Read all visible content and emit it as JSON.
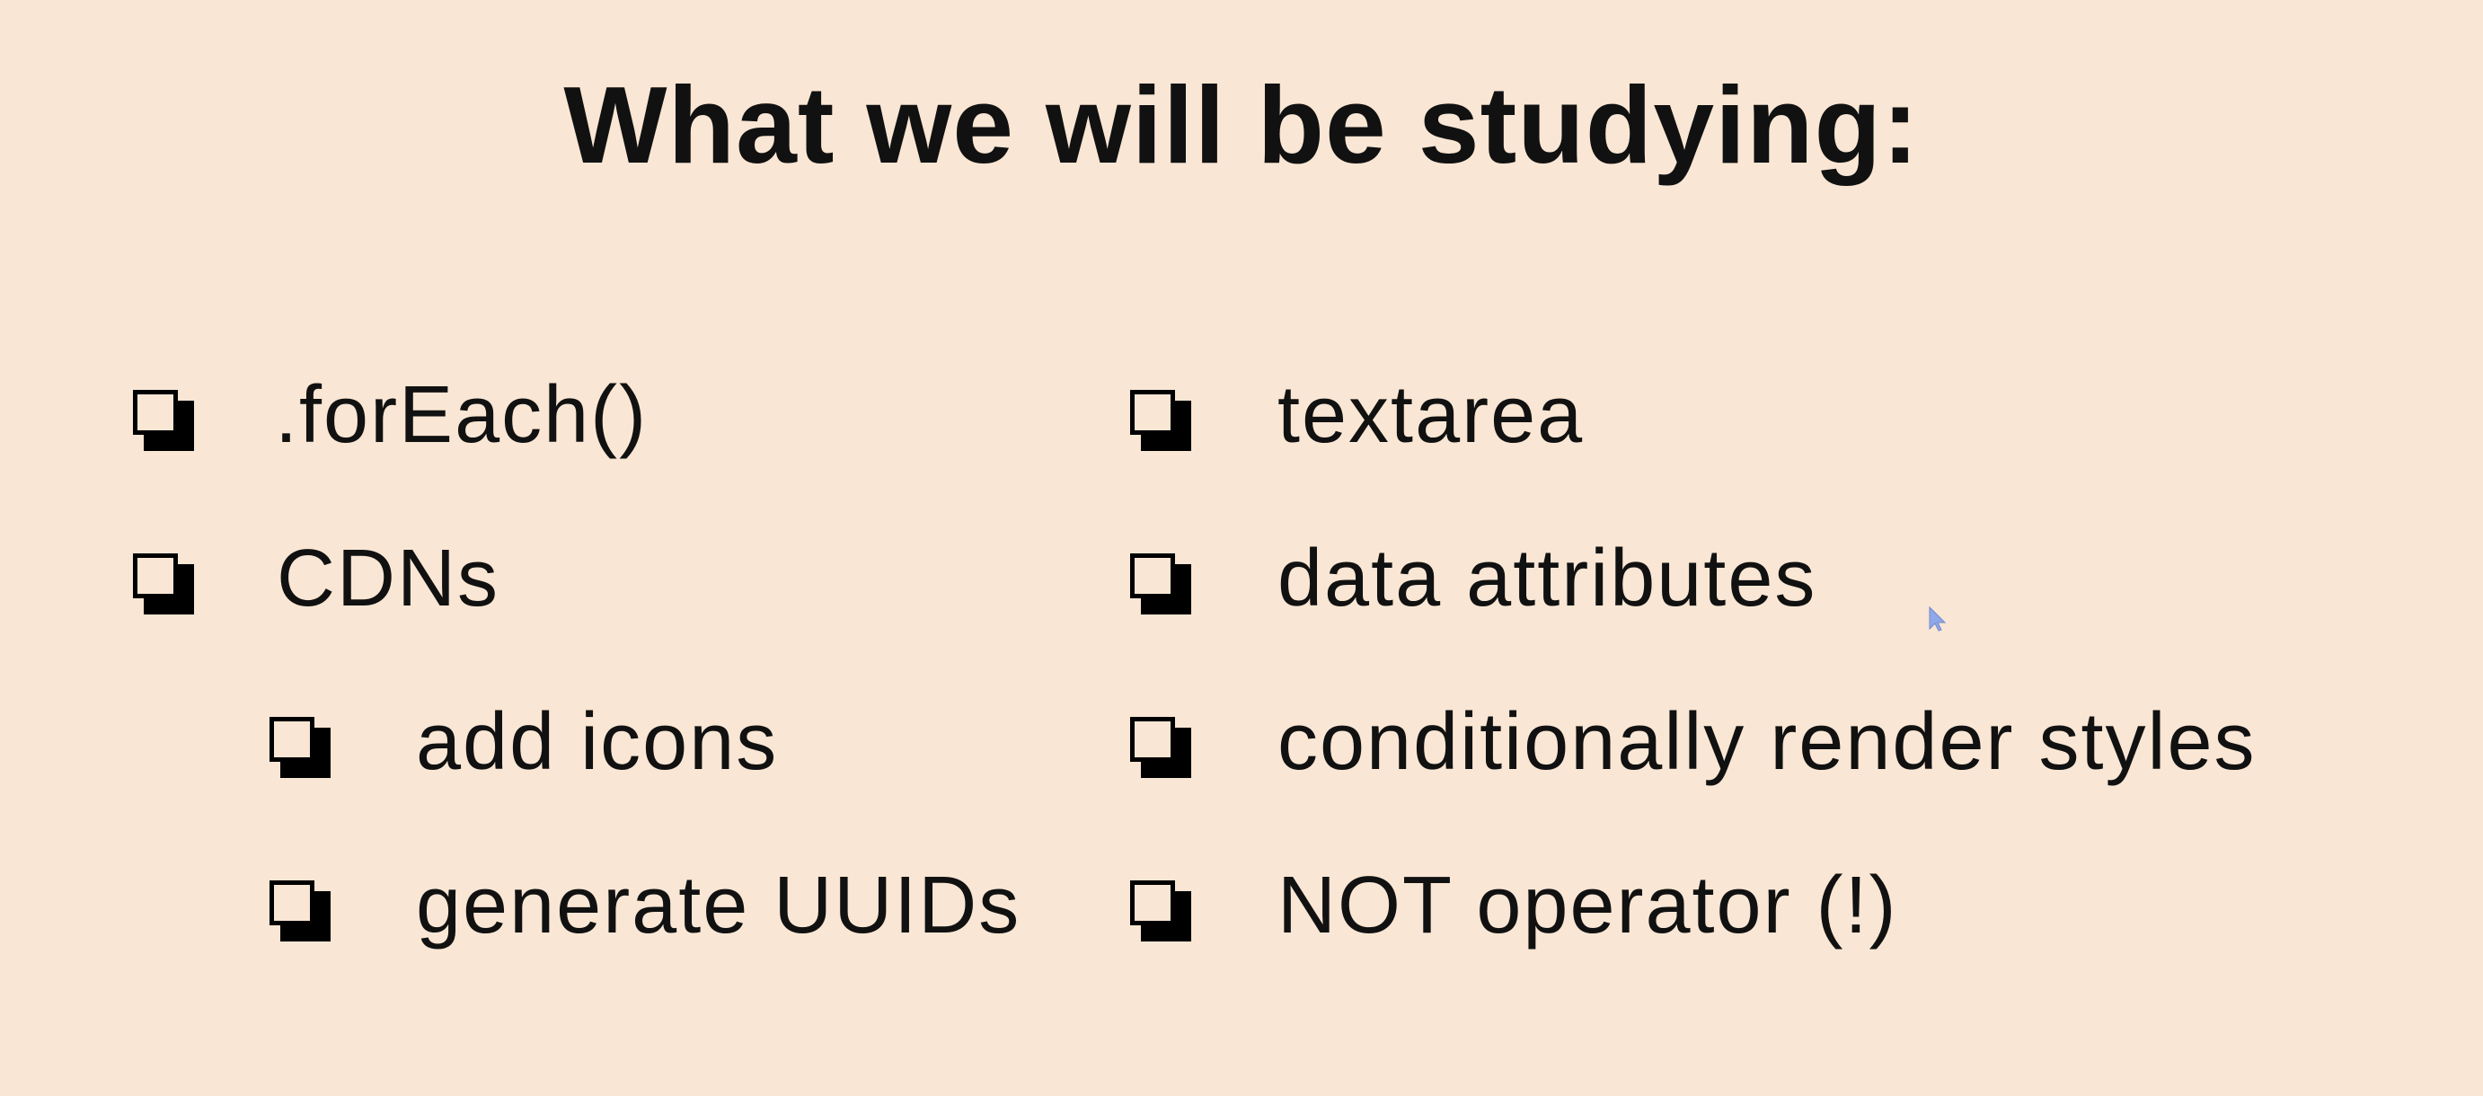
{
  "slide": {
    "title": "What we will be studying:",
    "left_column": [
      {
        "label": ".forEach()",
        "level": 0
      },
      {
        "label": "CDNs",
        "level": 0
      },
      {
        "label": "add icons",
        "level": 1
      },
      {
        "label": "generate UUIDs",
        "level": 1
      }
    ],
    "right_column": [
      {
        "label": "textarea",
        "level": 0
      },
      {
        "label": "data attributes",
        "level": 0
      },
      {
        "label": "conditionally render styles",
        "level": 0
      },
      {
        "label": "NOT operator (!)",
        "level": 0
      }
    ]
  },
  "colors": {
    "background": "#f9e6d4",
    "text": "#111111",
    "checkbox": "#000000",
    "cursor": "#8fa8e8"
  },
  "icons": {
    "checkbox": "checkbox-icon",
    "cursor": "mouse-pointer-icon"
  }
}
